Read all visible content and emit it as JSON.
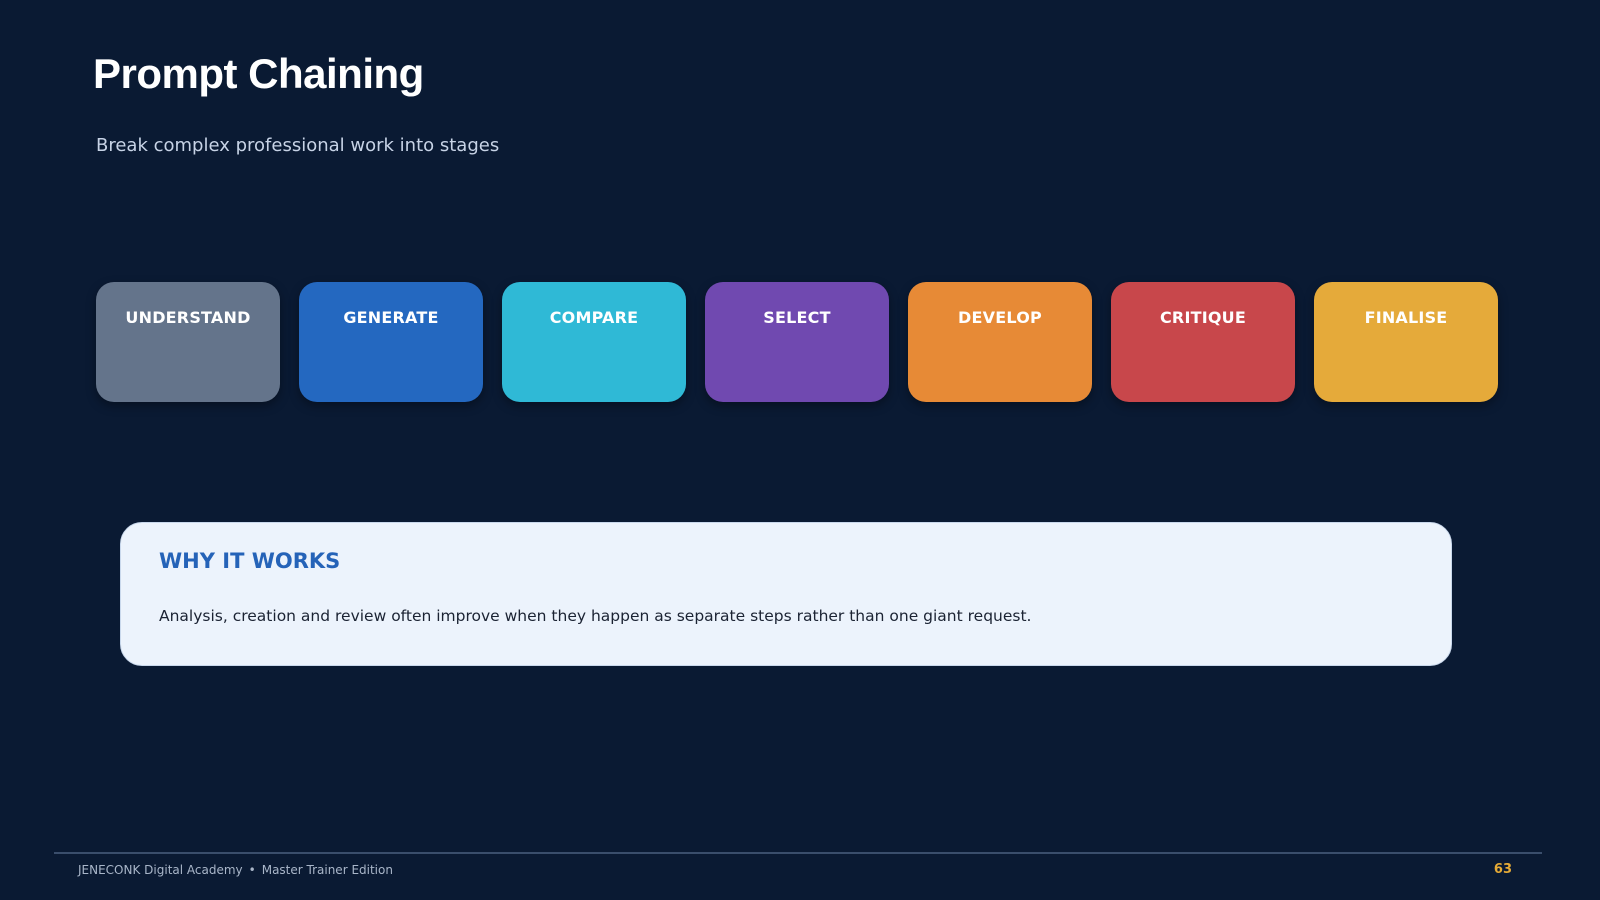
{
  "slide": {
    "title": "Prompt Chaining",
    "subtitle": "Break complex professional work into stages"
  },
  "stages": [
    {
      "label": "UNDERSTAND",
      "color": "#64748b"
    },
    {
      "label": "GENERATE",
      "color": "#2468c0"
    },
    {
      "label": "COMPARE",
      "color": "#2fb9d6"
    },
    {
      "label": "SELECT",
      "color": "#7049b0"
    },
    {
      "label": "DEVELOP",
      "color": "#e78a36"
    },
    {
      "label": "CRITIQUE",
      "color": "#c8474b"
    },
    {
      "label": "FINALISE",
      "color": "#e5aa3a"
    }
  ],
  "why": {
    "heading": "WHY IT WORKS",
    "body": "Analysis, creation and review often improve when they happen as separate steps rather than one giant request."
  },
  "footer": {
    "org": "JENECONK Digital Academy",
    "separator": "•",
    "edition": "Master Trainer Edition",
    "page_number": "63"
  },
  "colors": {
    "background": "#0a1a33",
    "accent": "#2563b8",
    "page_number": "#e5aa36"
  }
}
